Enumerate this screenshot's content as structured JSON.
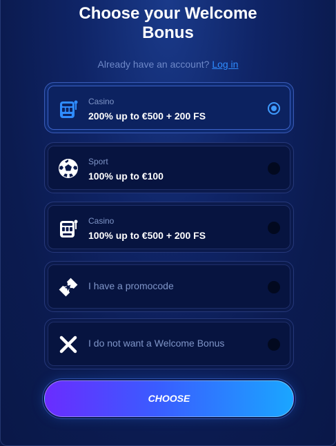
{
  "header": {
    "title": "Choose your Welcome Bonus",
    "account_prompt": "Already have an account?",
    "login_link": "Log in"
  },
  "options": [
    {
      "category": "Casino",
      "title": "200% up to €500 + 200 FS",
      "icon": "slot-machine-icon",
      "selected": true
    },
    {
      "category": "Sport",
      "title": "100% up to €100",
      "icon": "soccer-ball-icon",
      "selected": false
    },
    {
      "category": "Casino",
      "title": "100% up to €500 + 200 FS",
      "icon": "slot-machine-icon",
      "selected": false
    },
    {
      "category": "",
      "title": "I have a promocode",
      "icon": "ticket-star-icon",
      "selected": false
    },
    {
      "category": "",
      "title": "I do not want a Welcome Bonus",
      "icon": "close-x-icon",
      "selected": false
    }
  ],
  "action": {
    "choose_label": "CHOOSE"
  },
  "colors": {
    "accent": "#2f8cff",
    "background": "#0b1b50",
    "button_gradient_start": "#6a2cff",
    "button_gradient_end": "#1aa6ff"
  }
}
